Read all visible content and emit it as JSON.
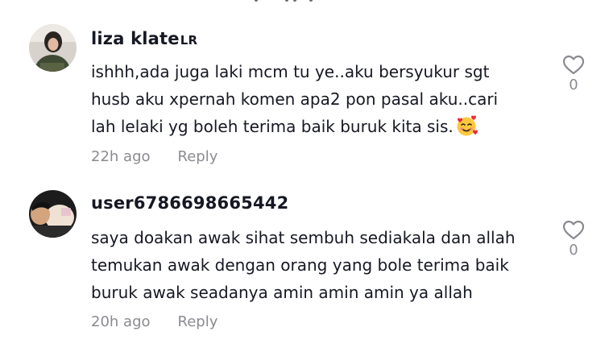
{
  "comments": [
    {
      "username": "liza klate",
      "username_suffix": "LR",
      "text_lines": [
        "ishhh,ada juga laki mcm tu ye..aku bersyukur sgt",
        "husb aku xpernah komen apa2 pon pasal aku..cari",
        "lah lelaki yg boleh terima baik buruk kita sis."
      ],
      "emoji": "smiling-face-with-hearts-emoji",
      "time": "22h ago",
      "reply_label": "Reply",
      "like_icon": "heart-outline-icon",
      "like_count": "0"
    },
    {
      "username": "user6786698665442",
      "username_suffix": "",
      "text_lines": [
        "saya doakan awak sihat sembuh sediakala dan allah",
        "temukan awak dengan orang yang bole terima baik",
        "buruk awak seadanya amin amin amin ya allah"
      ],
      "time": "20h ago",
      "reply_label": "Reply",
      "like_icon": "heart-outline-icon",
      "like_count": "0"
    }
  ],
  "colors": {
    "text_primary": "#161823",
    "text_secondary": "#8a8b91",
    "emoji_face": "#FFC83D"
  }
}
